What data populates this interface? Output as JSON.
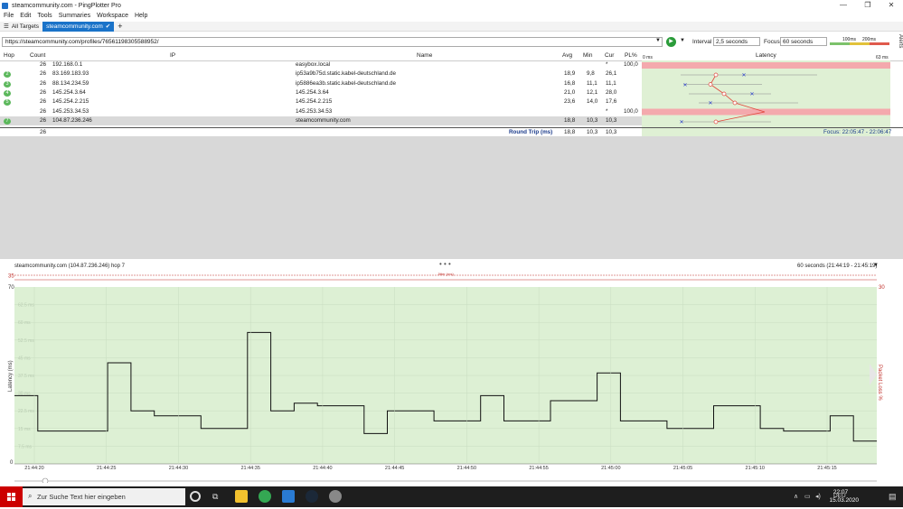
{
  "window": {
    "title": "steamcommunity.com - PingPlotter Pro",
    "min_label": "—",
    "max_label": "❐",
    "close_label": "✕"
  },
  "menu": [
    "File",
    "Edit",
    "Tools",
    "Summaries",
    "Workspace",
    "Help"
  ],
  "tabs": [
    {
      "label": "All Targets"
    },
    {
      "label": "steamcommunity.com"
    }
  ],
  "add_tab_label": "+",
  "address": {
    "value": "https://steamcommunity.com/profiles/76561198305588952/"
  },
  "controls": {
    "interval_label": "Interval",
    "interval_value": "2,5 seconds",
    "focus_label": "Focus",
    "focus_value": "60 seconds"
  },
  "legend_scale": {
    "low": "100ms",
    "high": "200ms"
  },
  "alerts_label": "Alerts",
  "table": {
    "headers": {
      "hop": "Hop",
      "count": "Count",
      "ip": "IP",
      "name": "Name",
      "avg": "Avg",
      "min": "Min",
      "cur": "Cur",
      "pl": "PL%",
      "latency": "Latency",
      "lat_start": "0 ms",
      "lat_end": "63 ms"
    },
    "rows": [
      {
        "hop": "1",
        "count": "26",
        "ip": "192.168.0.1",
        "name": "easybox.local",
        "avg": "",
        "min": "",
        "cur": "*",
        "pl": "100,0"
      },
      {
        "hop": "2",
        "count": "26",
        "ip": "83.169.183.93",
        "name": "ip53a9b75d.static.kabel-deutschland.de",
        "avg": "18,9",
        "min": "9,8",
        "cur": "26,1",
        "pl": ""
      },
      {
        "hop": "3",
        "count": "26",
        "ip": "88.134.234.59",
        "name": "ip5886ea3b.static.kabel-deutschland.de",
        "avg": "16,8",
        "min": "11,1",
        "cur": "11,1",
        "pl": ""
      },
      {
        "hop": "4",
        "count": "26",
        "ip": "145.254.3.64",
        "name": "145.254.3.64",
        "avg": "21,0",
        "min": "12,1",
        "cur": "28,0",
        "pl": ""
      },
      {
        "hop": "5",
        "count": "26",
        "ip": "145.254.2.215",
        "name": "145.254.2.215",
        "avg": "23,6",
        "min": "14,0",
        "cur": "17,6",
        "pl": ""
      },
      {
        "hop": "6",
        "count": "26",
        "ip": "145.253.34.53",
        "name": "145.253.34.53",
        "avg": "",
        "min": "",
        "cur": "*",
        "pl": "100,0"
      },
      {
        "hop": "7",
        "count": "26",
        "ip": "104.87.236.246",
        "name": "steamcommunity.com",
        "avg": "18,8",
        "min": "10,3",
        "cur": "10,3",
        "pl": ""
      }
    ],
    "summary": {
      "count": "26",
      "label": "Round Trip (ms)",
      "avg": "18,8",
      "min": "10,3",
      "cur": "10,3",
      "focus": "Focus: 22:05:47 - 22:06:47"
    }
  },
  "graph": {
    "target_label": "steamcommunity.com (104.87.236.246) hop 7",
    "range_label": "60 seconds (21:44:19 - 21:45:19)",
    "jitter_label": "Jitter (ms)",
    "jitter_max": "35",
    "pl_max": "30",
    "ylabel": "Latency (ms)",
    "y2label": "Packet Loss %",
    "yticks": [
      "70",
      "0"
    ],
    "ygrid": [
      "62.5 ms",
      "60 ms",
      "52.5 ms",
      "45 ms",
      "37.5 ms",
      "30 ms",
      "22.5 ms",
      "15 ms",
      "7.5 ms"
    ],
    "xticks": [
      "21:44:20",
      "21:44:25",
      "21:44:30",
      "21:44:35",
      "21:44:40",
      "21:44:45",
      "21:44:50",
      "21:44:55",
      "21:45:00",
      "21:45:05",
      "21:45:10",
      "21:45:15"
    ]
  },
  "chart_data": {
    "type": "line",
    "title": "steamcommunity.com (104.87.236.246) hop 7",
    "xlabel": "",
    "ylabel": "Latency (ms)",
    "ylim": [
      0,
      70
    ],
    "series": [
      {
        "name": "",
        "values": [
          27,
          13,
          13,
          13,
          40,
          21,
          19,
          19,
          14,
          14,
          52,
          21,
          24,
          23,
          23,
          12,
          21,
          21,
          17,
          17,
          27,
          17,
          17,
          25,
          25,
          36,
          17,
          17,
          14,
          14,
          23,
          23,
          14,
          13,
          13,
          19,
          9
        ]
      }
    ]
  },
  "taskbar": {
    "search_placeholder": "Zur Suche Text hier eingeben",
    "time": "22:07",
    "date": "15.03.2020",
    "lang": "DEU"
  }
}
